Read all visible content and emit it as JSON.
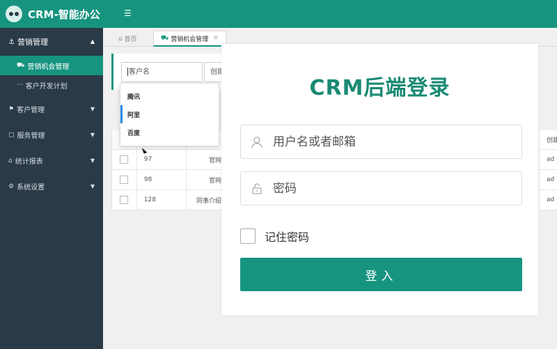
{
  "app": {
    "title": "CRM-智能办公",
    "menu_toggle_icon": "menu-toggle-icon"
  },
  "sidebar": {
    "section": {
      "label": "营销管理",
      "expanded": true
    },
    "sub_items": [
      {
        "label": "营销机会管理",
        "active": true
      },
      {
        "label": "客户开发计划",
        "active": false
      }
    ],
    "items": [
      {
        "label": "客户管理"
      },
      {
        "label": "服务管理"
      },
      {
        "label": "统计报表"
      },
      {
        "label": "系统设置"
      }
    ]
  },
  "tabs": [
    {
      "label": "首页",
      "active": false
    },
    {
      "label": "营销机会管理",
      "active": true,
      "closable": true
    }
  ],
  "filter": {
    "customer_placeholder": "客户名",
    "creator_placeholder": "创建",
    "suggestions": [
      "腾讯",
      "阿里",
      "百度"
    ],
    "selected_suggestion": "阿里"
  },
  "table": {
    "rows": [
      {
        "id": "97",
        "source": "官网",
        "right": "ad"
      },
      {
        "id": "98",
        "source": "官网",
        "right": "ad"
      },
      {
        "id": "128",
        "source": "同事介绍",
        "right": "ad"
      }
    ],
    "right_header": "创建"
  },
  "login": {
    "title": "CRM后端登录",
    "username_placeholder": "用户名或者邮箱",
    "password_placeholder": "密码",
    "remember_label": "记住密码",
    "submit_label": "登入"
  },
  "colors": {
    "primary": "#16947f",
    "sidebar": "#2b3a47",
    "title": "#1a8a73"
  }
}
